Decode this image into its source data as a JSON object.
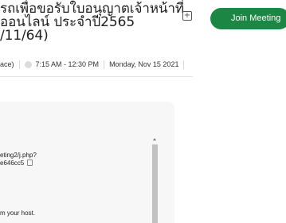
{
  "meeting": {
    "title_line1": "รถเพื่อขอรับใบอนุญาตเจ้าหน้าที่",
    "title_line2": "ออนไลน์ ประจำปี2565",
    "title_line3": "/11/64)",
    "join_label": "Join Meeting",
    "add_calendar_icon": "plus-box-icon"
  },
  "meta": {
    "location": "ace)",
    "time": "7:15 AM - 12:30 PM",
    "date": "Monday, Nov 15 2021"
  },
  "info_panel": {
    "link_line1": "eting2/j.php?",
    "link_line2": "e646cc5",
    "host_text": "m your host."
  }
}
